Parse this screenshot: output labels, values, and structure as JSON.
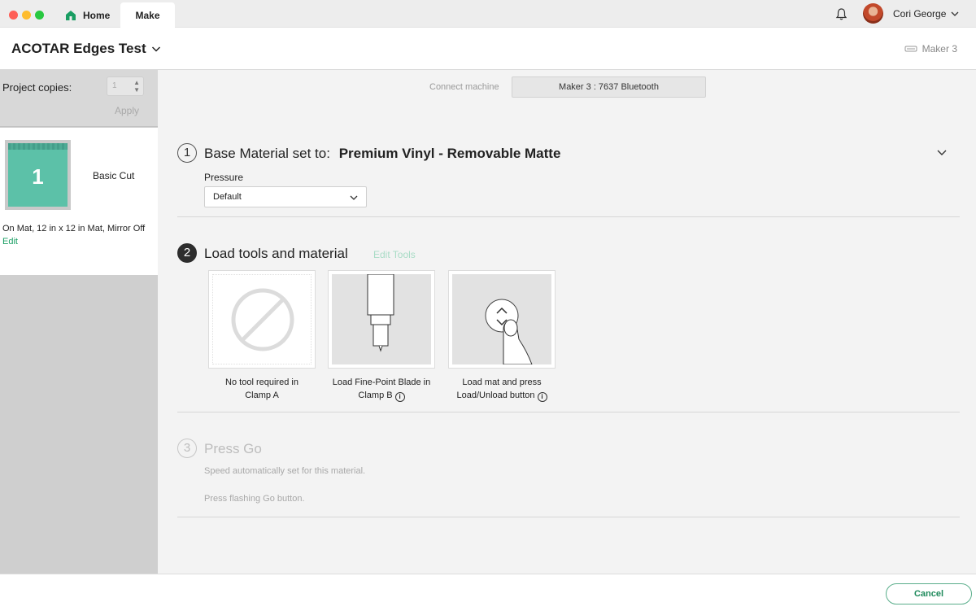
{
  "tabs": {
    "home": "Home",
    "make": "Make"
  },
  "user": {
    "name": "Cori George"
  },
  "header": {
    "project_title": "ACOTAR Edges Test",
    "machine": "Maker 3"
  },
  "sidebar": {
    "copies_label": "Project copies:",
    "copies_value": "1",
    "apply_label": "Apply",
    "mat": {
      "number": "1",
      "cut_type": "Basic Cut",
      "info": "On Mat, 12 in x 12 in Mat, Mirror Off",
      "edit": "Edit"
    }
  },
  "connect": {
    "label": "Connect machine",
    "button": "Maker 3 : 7637 Bluetooth"
  },
  "step1": {
    "number": "1",
    "title": "Base Material set to:",
    "material": "Premium Vinyl - Removable Matte",
    "pressure_label": "Pressure",
    "pressure_value": "Default"
  },
  "step2": {
    "number": "2",
    "title": "Load tools and material",
    "edit_tools": "Edit Tools",
    "cards": [
      {
        "line1": "No tool required in",
        "line2": "Clamp A"
      },
      {
        "line1": "Load Fine-Point Blade in",
        "line2": "Clamp B"
      },
      {
        "line1": "Load mat and press",
        "line2": "Load/Unload button"
      }
    ]
  },
  "step3": {
    "number": "3",
    "title": "Press Go",
    "line1": "Speed automatically set for this material.",
    "line2": "Press flashing Go button."
  },
  "footer": {
    "cancel": "Cancel"
  },
  "colors": {
    "accent": "#1f8a5c",
    "mat": "#5cc1a8",
    "active_step": "#2d2d2d"
  },
  "icons": [
    "home-icon",
    "bell-icon",
    "chevron-down-icon",
    "machine-icon",
    "info-icon",
    "no-tool-icon",
    "blade-icon",
    "load-button-icon"
  ]
}
